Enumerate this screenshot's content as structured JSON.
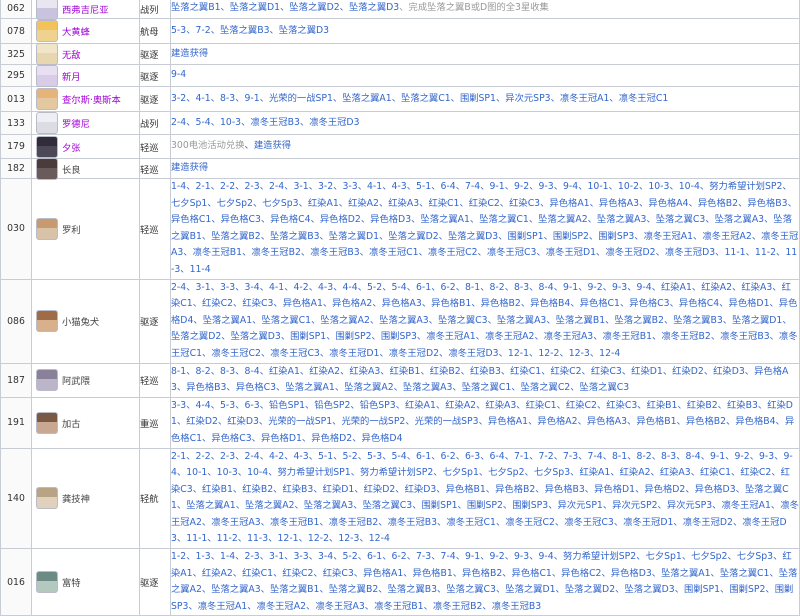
{
  "rows": [
    {
      "id": "062",
      "name": "西弗吉尼亚",
      "name_style": "purple",
      "type": "战列",
      "avatar_color": "#c9c4de",
      "hair_color": "#e9e6f2",
      "sources": [
        {
          "t": "坠落之翼B1"
        },
        {
          "t": "坠落之翼D1"
        },
        {
          "t": "坠落之翼D2"
        },
        {
          "t": "坠落之翼D3"
        },
        {
          "t": "完成坠落之翼B或D图的全3星收集",
          "gray": true
        }
      ]
    },
    {
      "id": "078",
      "name": "大黄蜂",
      "name_style": "purple",
      "type": "航母",
      "avatar_color": "#f0d290",
      "hair_color": "#f3c35a",
      "sources": [
        {
          "t": "5-3"
        },
        {
          "t": "7-2"
        },
        {
          "t": "坠落之翼B3"
        },
        {
          "t": "坠落之翼D3"
        }
      ]
    },
    {
      "id": "325",
      "name": "无敌",
      "name_style": "purple",
      "type": "驱逐",
      "avatar_color": "#e8d6b0",
      "hair_color": "#f1e4c8",
      "sources": [
        {
          "t": "建造获得"
        }
      ]
    },
    {
      "id": "295",
      "name": "新月",
      "name_style": "purple",
      "type": "驱逐",
      "avatar_color": "#d8cce6",
      "hair_color": "#e9dff2",
      "sources": [
        {
          "t": "9-4"
        }
      ]
    },
    {
      "id": "013",
      "name": "查尔斯·奥斯本",
      "name_style": "purple",
      "type": "驱逐",
      "avatar_color": "#e4c8a0",
      "hair_color": "#e6b37a",
      "sources": [
        {
          "t": "3-2"
        },
        {
          "t": "4-1"
        },
        {
          "t": "8-3"
        },
        {
          "t": "9-1"
        },
        {
          "t": "光荣的一战SP1"
        },
        {
          "t": "坠落之翼A1"
        },
        {
          "t": "坠落之翼C1"
        },
        {
          "t": "围剿SP1"
        },
        {
          "t": "异次元SP3"
        },
        {
          "t": "凛冬王冠A1"
        },
        {
          "t": "凛冬王冠C1"
        }
      ]
    },
    {
      "id": "133",
      "name": "罗德尼",
      "name_style": "purple",
      "type": "战列",
      "avatar_color": "#dcdce4",
      "hair_color": "#eeeeF4",
      "sources": [
        {
          "t": "2-4"
        },
        {
          "t": "5-4"
        },
        {
          "t": "10-3"
        },
        {
          "t": "凛冬王冠B3"
        },
        {
          "t": "凛冬王冠D3"
        }
      ]
    },
    {
      "id": "179",
      "name": "夕张",
      "name_style": "purple",
      "type": "轻巡",
      "avatar_color": "#4c4858",
      "hair_color": "#302c3a",
      "sources": [
        {
          "t": "300电池活动兑换",
          "gray": true
        },
        {
          "t": "建造获得"
        }
      ]
    },
    {
      "id": "182",
      "name": "长良",
      "name_style": "plain",
      "type": "轻巡",
      "avatar_color": "#6a5a5a",
      "hair_color": "#4a3c3c",
      "sources": [
        {
          "t": "建造获得"
        }
      ]
    },
    {
      "id": "030",
      "name": "罗利",
      "name_style": "plain",
      "type": "轻巡",
      "avatar_color": "#d8c2a8",
      "hair_color": "#c89a70",
      "sources": [
        {
          "t": "1-4"
        },
        {
          "t": "2-1"
        },
        {
          "t": "2-2"
        },
        {
          "t": "2-3"
        },
        {
          "t": "2-4"
        },
        {
          "t": "3-1"
        },
        {
          "t": "3-2"
        },
        {
          "t": "3-3"
        },
        {
          "t": "4-1"
        },
        {
          "t": "4-3"
        },
        {
          "t": "5-1"
        },
        {
          "t": "6-4"
        },
        {
          "t": "7-4"
        },
        {
          "t": "9-1"
        },
        {
          "t": "9-2"
        },
        {
          "t": "9-3"
        },
        {
          "t": "9-4"
        },
        {
          "t": "10-1"
        },
        {
          "t": "10-2"
        },
        {
          "t": "10-3"
        },
        {
          "t": "10-4"
        },
        {
          "t": "努力希望计划SP2"
        },
        {
          "t": "七夕Sp1"
        },
        {
          "t": "七夕Sp2"
        },
        {
          "t": "七夕Sp3"
        },
        {
          "t": "红染A1"
        },
        {
          "t": "红染A2"
        },
        {
          "t": "红染A3"
        },
        {
          "t": "红染C1"
        },
        {
          "t": "红染C2"
        },
        {
          "t": "红染C3"
        },
        {
          "t": "异色格A1"
        },
        {
          "t": "异色格A3"
        },
        {
          "t": "异色格A4"
        },
        {
          "t": "异色格B2"
        },
        {
          "t": "异色格B3"
        },
        {
          "t": "异色格C1"
        },
        {
          "t": "异色格C3"
        },
        {
          "t": "异色格C4"
        },
        {
          "t": "异色格D2"
        },
        {
          "t": "异色格D3"
        },
        {
          "t": "坠落之翼A1"
        },
        {
          "t": "坠落之翼C1"
        },
        {
          "t": "坠落之翼A2"
        },
        {
          "t": "坠落之翼A3"
        },
        {
          "t": "坠落之翼C3"
        },
        {
          "t": "坠落之翼A3"
        },
        {
          "t": "坠落之翼B1"
        },
        {
          "t": "坠落之翼B2"
        },
        {
          "t": "坠落之翼B3"
        },
        {
          "t": "坠落之翼D1"
        },
        {
          "t": "坠落之翼D2"
        },
        {
          "t": "坠落之翼D3"
        },
        {
          "t": "围剿SP1"
        },
        {
          "t": "围剿SP2"
        },
        {
          "t": "围剿SP3"
        },
        {
          "t": "凛冬王冠A1"
        },
        {
          "t": "凛冬王冠A2"
        },
        {
          "t": "凛冬王冠A3"
        },
        {
          "t": "凛冬王冠B1"
        },
        {
          "t": "凛冬王冠B2"
        },
        {
          "t": "凛冬王冠B3"
        },
        {
          "t": "凛冬王冠C1"
        },
        {
          "t": "凛冬王冠C2"
        },
        {
          "t": "凛冬王冠C3"
        },
        {
          "t": "凛冬王冠D1"
        },
        {
          "t": "凛冬王冠D2"
        },
        {
          "t": "凛冬王冠D3"
        },
        {
          "t": "11-1"
        },
        {
          "t": "11-2"
        },
        {
          "t": "11-3"
        },
        {
          "t": "11-4"
        }
      ]
    },
    {
      "id": "086",
      "name": "小猫兔犬",
      "name_style": "plain",
      "type": "驱逐",
      "avatar_color": "#d8b08c",
      "hair_color": "#a06c48",
      "sources": [
        {
          "t": "2-4"
        },
        {
          "t": "3-1"
        },
        {
          "t": "3-3"
        },
        {
          "t": "3-4"
        },
        {
          "t": "4-1"
        },
        {
          "t": "4-2"
        },
        {
          "t": "4-3"
        },
        {
          "t": "4-4"
        },
        {
          "t": "5-2"
        },
        {
          "t": "5-4"
        },
        {
          "t": "6-1"
        },
        {
          "t": "6-2"
        },
        {
          "t": "8-1"
        },
        {
          "t": "8-2"
        },
        {
          "t": "8-3"
        },
        {
          "t": "8-4"
        },
        {
          "t": "9-1"
        },
        {
          "t": "9-2"
        },
        {
          "t": "9-3"
        },
        {
          "t": "9-4"
        },
        {
          "t": "红染A1"
        },
        {
          "t": "红染A2"
        },
        {
          "t": "红染A3"
        },
        {
          "t": "红染C1"
        },
        {
          "t": "红染C2"
        },
        {
          "t": "红染C3"
        },
        {
          "t": "异色格A1"
        },
        {
          "t": "异色格A2"
        },
        {
          "t": "异色格A3"
        },
        {
          "t": "异色格B1"
        },
        {
          "t": "异色格B2"
        },
        {
          "t": "异色格B4"
        },
        {
          "t": "异色格C1"
        },
        {
          "t": "异色格C3"
        },
        {
          "t": "异色格C4"
        },
        {
          "t": "异色格D1"
        },
        {
          "t": "异色格D4"
        },
        {
          "t": "坠落之翼A1"
        },
        {
          "t": "坠落之翼C1"
        },
        {
          "t": "坠落之翼A2"
        },
        {
          "t": "坠落之翼A3"
        },
        {
          "t": "坠落之翼C3"
        },
        {
          "t": "坠落之翼A3"
        },
        {
          "t": "坠落之翼B1"
        },
        {
          "t": "坠落之翼B2"
        },
        {
          "t": "坠落之翼B3"
        },
        {
          "t": "坠落之翼D1"
        },
        {
          "t": "坠落之翼D2"
        },
        {
          "t": "坠落之翼D3"
        },
        {
          "t": "围剿SP1"
        },
        {
          "t": "围剿SP2"
        },
        {
          "t": "围剿SP3"
        },
        {
          "t": "凛冬王冠A1"
        },
        {
          "t": "凛冬王冠A2"
        },
        {
          "t": "凛冬王冠A3"
        },
        {
          "t": "凛冬王冠B1"
        },
        {
          "t": "凛冬王冠B2"
        },
        {
          "t": "凛冬王冠B3"
        },
        {
          "t": "凛冬王冠C1"
        },
        {
          "t": "凛冬王冠C2"
        },
        {
          "t": "凛冬王冠C3"
        },
        {
          "t": "凛冬王冠D1"
        },
        {
          "t": "凛冬王冠D2"
        },
        {
          "t": "凛冬王冠D3"
        },
        {
          "t": "12-1"
        },
        {
          "t": "12-2"
        },
        {
          "t": "12-3"
        },
        {
          "t": "12-4"
        }
      ]
    },
    {
      "id": "187",
      "name": "阿武隈",
      "name_style": "plain",
      "type": "轻巡",
      "avatar_color": "#bcb4c8",
      "hair_color": "#8a809a",
      "sources": [
        {
          "t": "8-1"
        },
        {
          "t": "8-2"
        },
        {
          "t": "8-3"
        },
        {
          "t": "8-4"
        },
        {
          "t": "红染A1"
        },
        {
          "t": "红染A2"
        },
        {
          "t": "红染A3"
        },
        {
          "t": "红染B1"
        },
        {
          "t": "红染B2"
        },
        {
          "t": "红染B3"
        },
        {
          "t": "红染C1"
        },
        {
          "t": "红染C2"
        },
        {
          "t": "红染C3"
        },
        {
          "t": "红染D1"
        },
        {
          "t": "红染D2"
        },
        {
          "t": "红染D3"
        },
        {
          "t": "异色格A3"
        },
        {
          "t": "异色格B3"
        },
        {
          "t": "异色格C3"
        },
        {
          "t": "坠落之翼A1"
        },
        {
          "t": "坠落之翼A2"
        },
        {
          "t": "坠落之翼A3"
        },
        {
          "t": "坠落之翼C1"
        },
        {
          "t": "坠落之翼C2"
        },
        {
          "t": "坠落之翼C3"
        }
      ]
    },
    {
      "id": "191",
      "name": "加古",
      "name_style": "plain",
      "type": "重巡",
      "avatar_color": "#c8a890",
      "hair_color": "#7a5a44",
      "sources": [
        {
          "t": "3-3"
        },
        {
          "t": "4-4"
        },
        {
          "t": "5-3"
        },
        {
          "t": "6-3"
        },
        {
          "t": "铅色SP1"
        },
        {
          "t": "铅色SP2"
        },
        {
          "t": "铅色SP3"
        },
        {
          "t": "红染A1"
        },
        {
          "t": "红染A2"
        },
        {
          "t": "红染A3"
        },
        {
          "t": "红染C1"
        },
        {
          "t": "红染C2"
        },
        {
          "t": "红染C3"
        },
        {
          "t": "红染B1"
        },
        {
          "t": "红染B2"
        },
        {
          "t": "红染B3"
        },
        {
          "t": "红染D1"
        },
        {
          "t": "红染D2"
        },
        {
          "t": "红染D3"
        },
        {
          "t": "光荣的一战SP1"
        },
        {
          "t": "光荣的一战SP2"
        },
        {
          "t": "光荣的一战SP3"
        },
        {
          "t": "异色格A1"
        },
        {
          "t": "异色格A2"
        },
        {
          "t": "异色格A3"
        },
        {
          "t": "异色格B1"
        },
        {
          "t": "异色格B2"
        },
        {
          "t": "异色格B4"
        },
        {
          "t": "异色格C1"
        },
        {
          "t": "异色格C3"
        },
        {
          "t": "异色格D1"
        },
        {
          "t": "异色格D2"
        },
        {
          "t": "异色格D4"
        }
      ]
    },
    {
      "id": "140",
      "name": "龚技神",
      "name_style": "plain",
      "type": "轻航",
      "avatar_color": "#e0d0bc",
      "hair_color": "#b8a484",
      "sources": [
        {
          "t": "2-1"
        },
        {
          "t": "2-2"
        },
        {
          "t": "2-3"
        },
        {
          "t": "2-4"
        },
        {
          "t": "4-2"
        },
        {
          "t": "4-3"
        },
        {
          "t": "5-1"
        },
        {
          "t": "5-2"
        },
        {
          "t": "5-3"
        },
        {
          "t": "5-4"
        },
        {
          "t": "6-1"
        },
        {
          "t": "6-2"
        },
        {
          "t": "6-3"
        },
        {
          "t": "6-4"
        },
        {
          "t": "7-1"
        },
        {
          "t": "7-2"
        },
        {
          "t": "7-3"
        },
        {
          "t": "7-4"
        },
        {
          "t": "8-1"
        },
        {
          "t": "8-2"
        },
        {
          "t": "8-3"
        },
        {
          "t": "8-4"
        },
        {
          "t": "9-1"
        },
        {
          "t": "9-2"
        },
        {
          "t": "9-3"
        },
        {
          "t": "9-4"
        },
        {
          "t": "10-1"
        },
        {
          "t": "10-3"
        },
        {
          "t": "10-4"
        },
        {
          "t": "努力希望计划SP1"
        },
        {
          "t": "努力希望计划SP2"
        },
        {
          "t": "七夕Sp1"
        },
        {
          "t": "七夕Sp2"
        },
        {
          "t": "七夕Sp3"
        },
        {
          "t": "红染A1"
        },
        {
          "t": "红染A2"
        },
        {
          "t": "红染A3"
        },
        {
          "t": "红染C1"
        },
        {
          "t": "红染C2"
        },
        {
          "t": "红染C3"
        },
        {
          "t": "红染B1"
        },
        {
          "t": "红染B2"
        },
        {
          "t": "红染B3"
        },
        {
          "t": "红染D1"
        },
        {
          "t": "红染D2"
        },
        {
          "t": "红染D3"
        },
        {
          "t": "异色格B1"
        },
        {
          "t": "异色格B2"
        },
        {
          "t": "异色格B3"
        },
        {
          "t": "异色格D1"
        },
        {
          "t": "异色格D2"
        },
        {
          "t": "异色格D3"
        },
        {
          "t": "坠落之翼C1"
        },
        {
          "t": "坠落之翼A1"
        },
        {
          "t": "坠落之翼A2"
        },
        {
          "t": "坠落之翼A3"
        },
        {
          "t": "坠落之翼C3"
        },
        {
          "t": "围剿SP1"
        },
        {
          "t": "围剿SP2"
        },
        {
          "t": "围剿SP3"
        },
        {
          "t": "异次元SP1"
        },
        {
          "t": "异次元SP2"
        },
        {
          "t": "异次元SP3"
        },
        {
          "t": "凛冬王冠A1"
        },
        {
          "t": "凛冬王冠A2"
        },
        {
          "t": "凛冬王冠A3"
        },
        {
          "t": "凛冬王冠B1"
        },
        {
          "t": "凛冬王冠B2"
        },
        {
          "t": "凛冬王冠B3"
        },
        {
          "t": "凛冬王冠C1"
        },
        {
          "t": "凛冬王冠C2"
        },
        {
          "t": "凛冬王冠C3"
        },
        {
          "t": "凛冬王冠D1"
        },
        {
          "t": "凛冬王冠D2"
        },
        {
          "t": "凛冬王冠D3"
        },
        {
          "t": "11-1"
        },
        {
          "t": "11-2"
        },
        {
          "t": "11-3"
        },
        {
          "t": "12-1"
        },
        {
          "t": "12-2"
        },
        {
          "t": "12-3"
        },
        {
          "t": "12-4"
        }
      ]
    },
    {
      "id": "016",
      "name": "富特",
      "name_style": "plain",
      "type": "驱逐",
      "avatar_color": "#b4c8c0",
      "hair_color": "#6a8c84",
      "sources": [
        {
          "t": "1-2"
        },
        {
          "t": "1-3"
        },
        {
          "t": "1-4"
        },
        {
          "t": "2-3"
        },
        {
          "t": "3-1"
        },
        {
          "t": "3-3"
        },
        {
          "t": "3-4"
        },
        {
          "t": "5-2"
        },
        {
          "t": "6-1"
        },
        {
          "t": "6-2"
        },
        {
          "t": "7-3"
        },
        {
          "t": "7-4"
        },
        {
          "t": "9-1"
        },
        {
          "t": "9-2"
        },
        {
          "t": "9-3"
        },
        {
          "t": "9-4"
        },
        {
          "t": "努力希望计划SP2"
        },
        {
          "t": "七夕Sp1"
        },
        {
          "t": "七夕Sp2"
        },
        {
          "t": "七夕Sp3"
        },
        {
          "t": "红染A1"
        },
        {
          "t": "红染A2"
        },
        {
          "t": "红染C1"
        },
        {
          "t": "红染C2"
        },
        {
          "t": "红染C3"
        },
        {
          "t": "异色格A1"
        },
        {
          "t": "异色格B1"
        },
        {
          "t": "异色格B2"
        },
        {
          "t": "异色格C1"
        },
        {
          "t": "异色格C2"
        },
        {
          "t": "异色格D3"
        },
        {
          "t": "坠落之翼A1"
        },
        {
          "t": "坠落之翼C1"
        },
        {
          "t": "坠落之翼A2"
        },
        {
          "t": "坠落之翼A3"
        },
        {
          "t": "坠落之翼B1"
        },
        {
          "t": "坠落之翼B2"
        },
        {
          "t": "坠落之翼B3"
        },
        {
          "t": "坠落之翼C3"
        },
        {
          "t": "坠落之翼D1"
        },
        {
          "t": "坠落之翼D2"
        },
        {
          "t": "坠落之翼D3"
        },
        {
          "t": "围剿SP1"
        },
        {
          "t": "围剿SP2"
        },
        {
          "t": "围剿SP3"
        },
        {
          "t": "凛冬王冠A1"
        },
        {
          "t": "凛冬王冠A2"
        },
        {
          "t": "凛冬王冠A3"
        },
        {
          "t": "凛冬王冠B1"
        },
        {
          "t": "凛冬王冠B2"
        },
        {
          "t": "凛冬王冠B3"
        }
      ]
    }
  ]
}
